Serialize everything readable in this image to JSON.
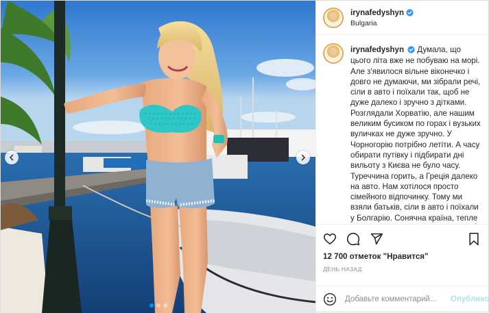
{
  "post": {
    "username": "irynafedyshyn",
    "location": "Bulgaria",
    "verified": true,
    "image_count": 3,
    "active_image_index": 0
  },
  "caption": {
    "text": "Думала, що цього літа вже не побуваю на морі. Але з'явилося вільне віконечко і довго не думаючи, ми зібрали речі, сіли в авто і поїхали так, щоб не дуже далеко і зручно з дітками. Розглядали Хорватію, але нашим великим бусиком по горах і вузьких вуличках не дуже зручно. У Чорногорію потрібно летіти. А часу обирати путівку і підбирати дні вильоту з Києва не було часу. Туреччина горить, а Греція далеко на авто. Нам хотілося просто сімейного відпочинку. Тому ми взяли батьків, сіли в авто і поїхали у Болгарію. Сонячна країна, тепле море, смачна їжа, приємні ціни 🥰 Заряджаємося позитивними емоціями та кайфуємо від часу"
  },
  "stats": {
    "likes": "12 700 отметок \"Нравится\"",
    "time_ago": "ДЕНЬ НАЗАД"
  },
  "comment_form": {
    "placeholder": "Добавьте комментарий...",
    "publish_label": "Опубликовать"
  },
  "icons": [
    "heart-icon",
    "comment-icon",
    "share-icon",
    "bookmark-icon",
    "emoji-icon",
    "verified-badge-icon",
    "chevron-left-icon",
    "chevron-right-icon"
  ],
  "colors": {
    "accent": "#0095f6",
    "publish_disabled": "#b2dffc",
    "muted": "#8e8e8e",
    "border": "#dbdbdb"
  }
}
